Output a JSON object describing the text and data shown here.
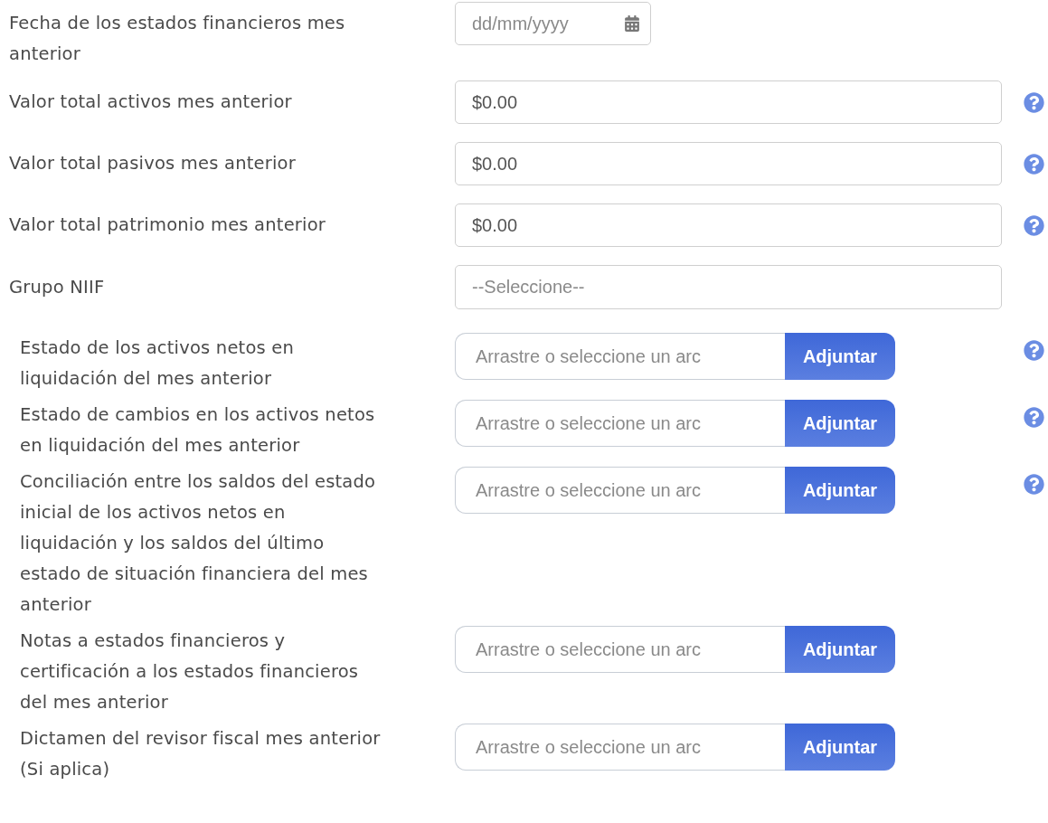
{
  "fields": [
    {
      "kind": "date",
      "label": "Fecha de los estados financieros mes anterior",
      "placeholder": "dd/mm/yyyy",
      "help": false
    },
    {
      "kind": "currency",
      "label": "Valor total activos mes anterior",
      "value": "$0.00",
      "help": true
    },
    {
      "kind": "currency",
      "label": "Valor total pasivos mes anterior",
      "value": "$0.00",
      "help": true
    },
    {
      "kind": "currency",
      "label": "Valor total patrimonio mes anterior",
      "value": "$0.00",
      "help": true
    },
    {
      "kind": "select",
      "label": "Grupo NIIF",
      "placeholder": "--Seleccione--",
      "help": false
    },
    {
      "kind": "file",
      "label": "Estado de los activos netos en liquidación del mes anterior",
      "placeholder": "Arrastre o seleccione un arc",
      "button": "Adjuntar",
      "help": true
    },
    {
      "kind": "file",
      "label": "Estado de cambios en los activos netos en liquidación del mes anterior",
      "placeholder": "Arrastre o seleccione un arc",
      "button": "Adjuntar",
      "help": true
    },
    {
      "kind": "file",
      "label": "Conciliación entre los saldos del estado inicial de los activos netos en liquidación y los saldos del último estado de situación financiera del mes anterior",
      "placeholder": "Arrastre o seleccione un arc",
      "button": "Adjuntar",
      "help": true
    },
    {
      "kind": "file",
      "label": "Notas a estados financieros y certificación a los estados financieros del mes anterior",
      "placeholder": "Arrastre o seleccione un arc",
      "button": "Adjuntar",
      "help": false
    },
    {
      "kind": "file",
      "label": "Dictamen del revisor fiscal mes anterior (Si aplica)",
      "placeholder": "Arrastre o seleccione un arc",
      "button": "Adjuntar",
      "help": false
    }
  ]
}
